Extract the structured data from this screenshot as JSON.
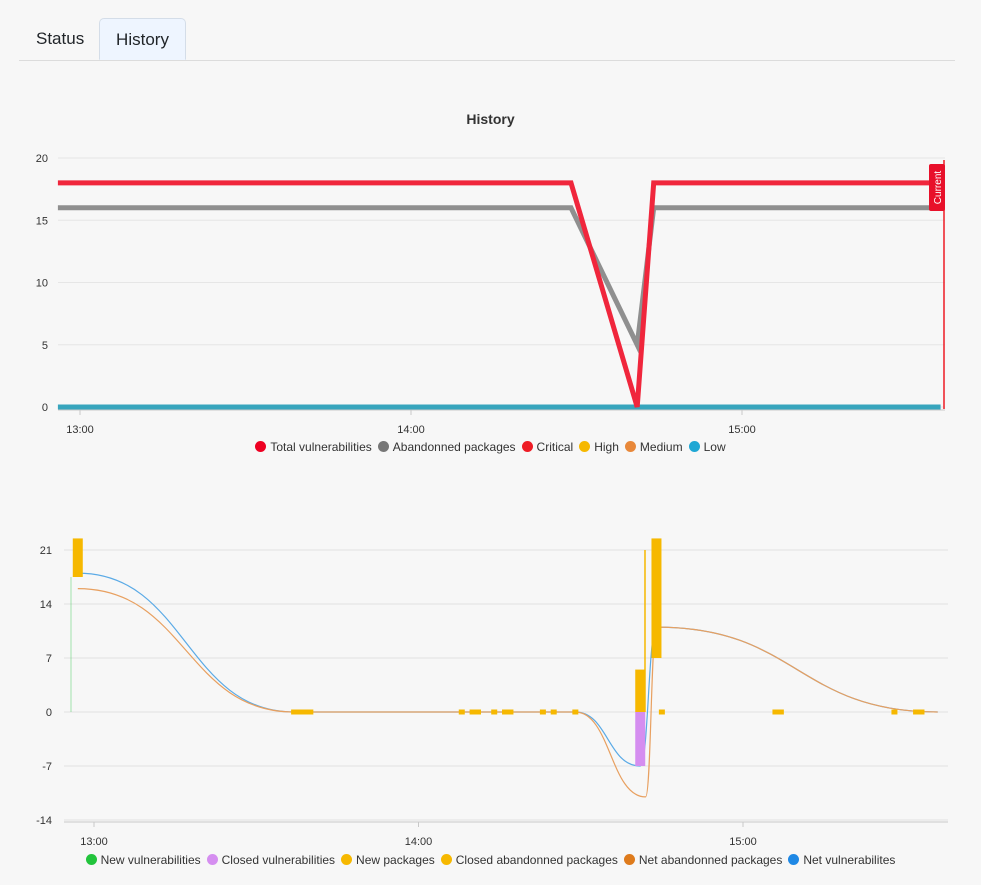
{
  "tabs": [
    {
      "label": "Status",
      "active": false
    },
    {
      "label": "History",
      "active": true
    }
  ],
  "chart_data": [
    {
      "type": "line",
      "title": "History",
      "x_ticks": [
        "13:00",
        "14:00",
        "15:00"
      ],
      "y_ticks": [
        "0",
        "5",
        "10",
        "15",
        "20"
      ],
      "ylim": [
        0,
        20
      ],
      "x_range": [
        "12:56",
        "15:36"
      ],
      "marker_label": "Current",
      "legend": [
        {
          "name": "Total vulnerabilities",
          "color": "#ee0022"
        },
        {
          "name": "Abandonned packages",
          "color": "#777777"
        },
        {
          "name": "Critical",
          "color": "#ee1c25"
        },
        {
          "name": "High",
          "color": "#f6b800"
        },
        {
          "name": "Medium",
          "color": "#e8883a"
        },
        {
          "name": "Low",
          "color": "#1fa7d4"
        }
      ],
      "series": [
        {
          "name": "Total vulnerabilities",
          "color": "#f0263c",
          "points": [
            [
              "12:56",
              18
            ],
            [
              "14:29",
              18
            ],
            [
              "14:41",
              0
            ],
            [
              "14:44",
              18
            ],
            [
              "15:36",
              18
            ]
          ]
        },
        {
          "name": "Abandonned packages",
          "color": "#8f8f8f",
          "points": [
            [
              "12:56",
              16
            ],
            [
              "14:29",
              16
            ],
            [
              "14:41",
              5
            ],
            [
              "14:44",
              16
            ],
            [
              "15:36",
              16
            ]
          ]
        },
        {
          "name": "Low",
          "color": "#37a5bd",
          "points": [
            [
              "12:56",
              0
            ],
            [
              "15:36",
              0
            ]
          ]
        }
      ]
    },
    {
      "type": "bar",
      "x_ticks": [
        "13:00",
        "14:00",
        "15:00"
      ],
      "y_ticks": [
        "21",
        "14",
        "7",
        "0",
        "-7",
        "-14"
      ],
      "ylim": [
        -14,
        21
      ],
      "legend": [
        {
          "name": "New vulnerabilities",
          "color": "#22c43c"
        },
        {
          "name": "Closed vulnerabilities",
          "color": "#d58ef0"
        },
        {
          "name": "New packages",
          "color": "#f6b800"
        },
        {
          "name": "Closed abandonned packages",
          "color": "#f6b800"
        },
        {
          "name": "Net abandonned packages",
          "color": "#de7b1c"
        },
        {
          "name": "Net vulnerabilites",
          "color": "#1e88e5"
        }
      ],
      "lines": [
        {
          "name": "Net vulnerabilites",
          "color": "#5aaae6",
          "points": [
            [
              "12:57",
              18
            ],
            [
              "13:37",
              0
            ],
            [
              "14:29",
              0
            ],
            [
              "14:41",
              -7
            ],
            [
              "14:44",
              11
            ],
            [
              "15:36",
              0
            ]
          ]
        },
        {
          "name": "Net abandonned packages",
          "color": "#e8a060",
          "points": [
            [
              "12:57",
              16
            ],
            [
              "13:37",
              0
            ],
            [
              "14:29",
              0
            ],
            [
              "14:42",
              -11
            ],
            [
              "14:44",
              11
            ],
            [
              "15:36",
              0
            ]
          ]
        }
      ],
      "bars": [
        {
          "series": "New packages",
          "x": "12:57",
          "from": 17.5,
          "to": 22.5
        },
        {
          "series": "New packages",
          "x": "14:41",
          "from": 0,
          "to": 5.5
        },
        {
          "series": "Closed vulnerabilities",
          "x": "14:41",
          "from": 0,
          "to": -7
        },
        {
          "series": "New packages",
          "x": "14:44",
          "from": 7,
          "to": 22.5
        },
        {
          "series": "New packages",
          "x": "14:41",
          "from": 0,
          "to": 21,
          "thin": true
        }
      ],
      "zero_marks": [
        "13:37",
        "13:38",
        "13:39",
        "13:40",
        "14:08",
        "14:10",
        "14:11",
        "14:14",
        "14:16",
        "14:17",
        "14:23",
        "14:25",
        "14:29",
        "14:45",
        "15:06",
        "15:07",
        "15:28",
        "15:32",
        "15:33"
      ]
    }
  ]
}
